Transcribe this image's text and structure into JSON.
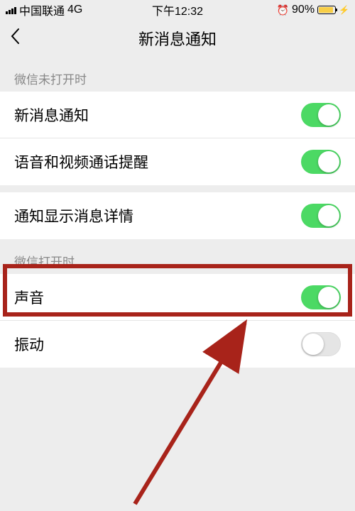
{
  "status_bar": {
    "carrier": "中国联通",
    "network": "4G",
    "time": "下午12:32",
    "battery_percent": "90%"
  },
  "nav": {
    "title": "新消息通知"
  },
  "sections": {
    "closed": {
      "header": "微信未打开时",
      "items": [
        {
          "label": "新消息通知"
        },
        {
          "label": "语音和视频通话提醒"
        }
      ]
    },
    "detail": {
      "label": "通知显示消息详情"
    },
    "open": {
      "header": "微信打开时",
      "items": [
        {
          "label": "声音"
        },
        {
          "label": "振动"
        }
      ]
    }
  }
}
